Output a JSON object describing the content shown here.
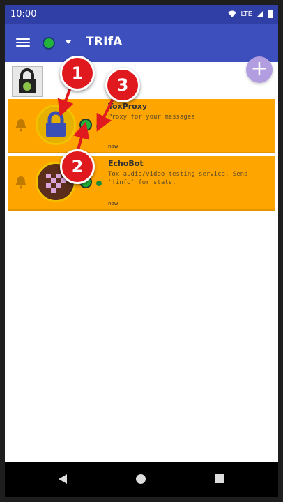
{
  "status_bar": {
    "time": "10:00",
    "network": "LTE"
  },
  "app_bar": {
    "title": "TRIfA"
  },
  "fab": {
    "label": "+"
  },
  "contacts": [
    {
      "name": "ToxProxy",
      "description": "Proxy for your messages",
      "time": "now"
    },
    {
      "name": "EchoBot",
      "description": "Tox audio/video testing service. Send '!info' for stats.",
      "time": "now"
    }
  ],
  "callouts": [
    "1",
    "2",
    "3"
  ],
  "colors": {
    "status_bar": "#2f3fa6",
    "app_bar": "#3c4fbd",
    "row_highlight": "#ffa500",
    "online": "#22b33b",
    "callout": "#e0191e"
  }
}
